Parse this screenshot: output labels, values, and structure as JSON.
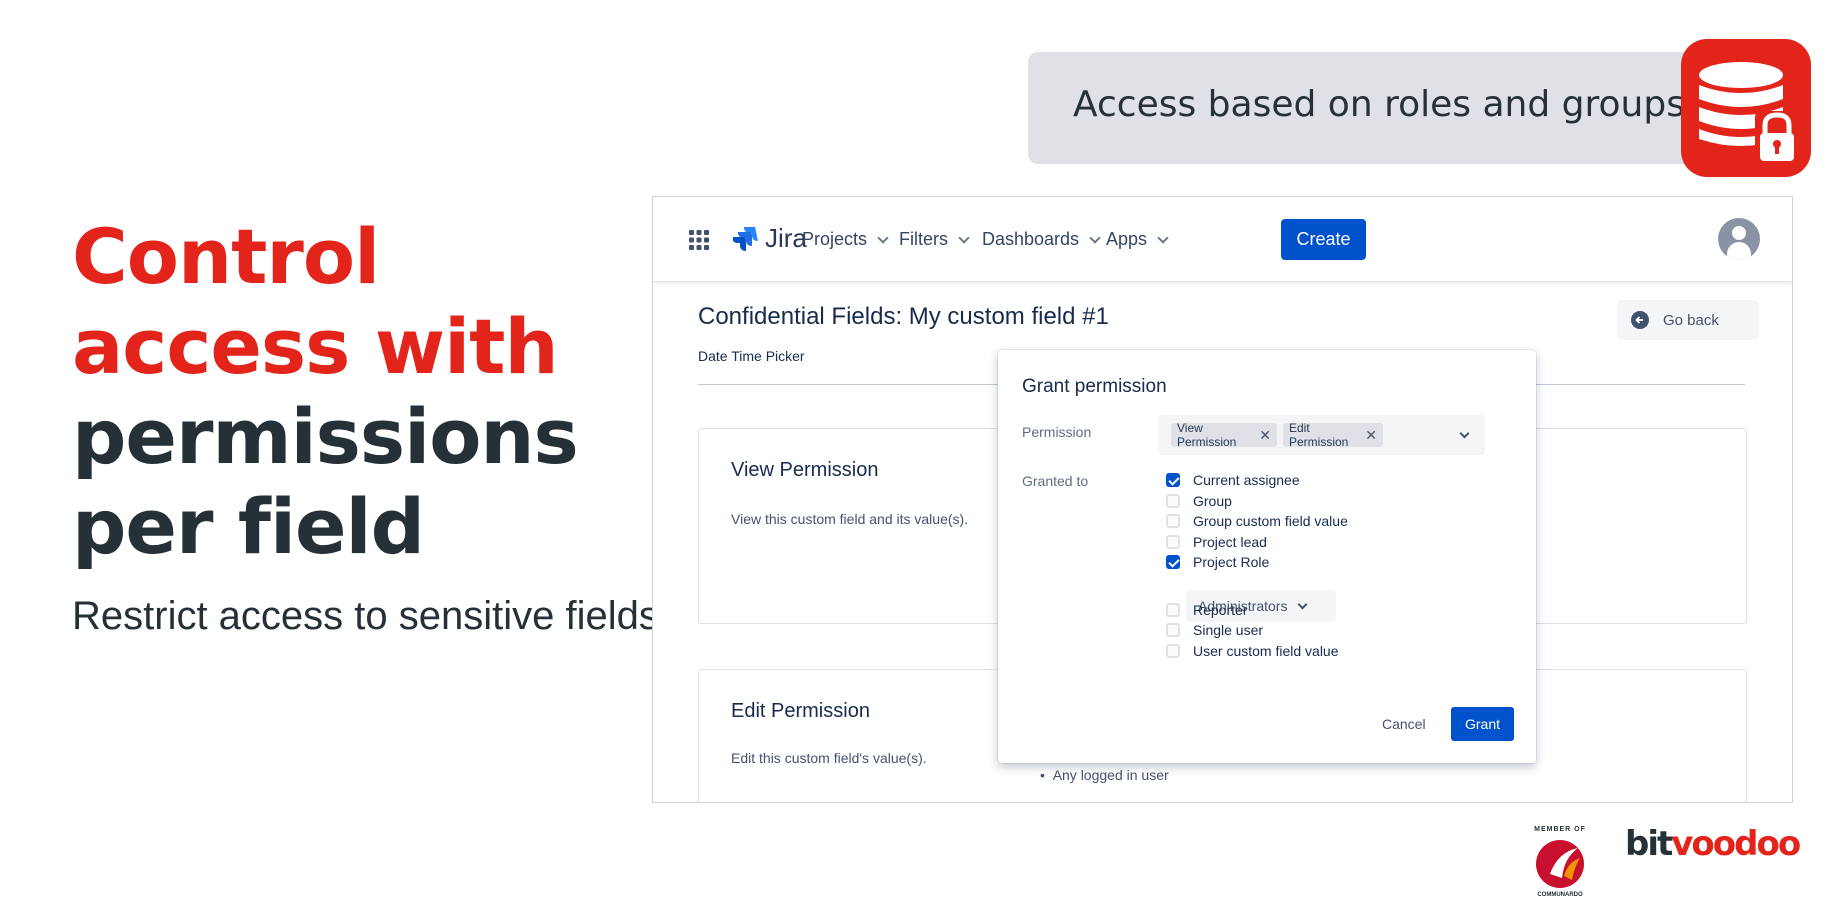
{
  "marketing": {
    "headline_red_1": "Control",
    "headline_red_2": "access with",
    "headline_dark_1": "permissions",
    "headline_dark_2": "per field",
    "subline": "Restrict access to sensitive fields",
    "banner_text": "Access based on roles and groups"
  },
  "app": {
    "brand": "Jira",
    "nav": {
      "projects": "Projects",
      "filters": "Filters",
      "dashboards": "Dashboards",
      "apps": "Apps",
      "create": "Create"
    },
    "page_title": "Confidential Fields: My custom field #1",
    "page_subtitle": "Date Time Picker",
    "go_back": "Go back",
    "cards": {
      "view_title": "View Permission",
      "view_desc": "View this custom field and its value(s).",
      "edit_title": "Edit Permission",
      "edit_desc": "Edit this custom field's value(s).",
      "edit_bullet": "Any logged in user"
    }
  },
  "modal": {
    "title": "Grant permission",
    "permission_label": "Permission",
    "granted_label": "Granted to",
    "tags": [
      "View Permission",
      "Edit Permission"
    ],
    "options": [
      {
        "label": "Current assignee",
        "checked": true
      },
      {
        "label": "Group",
        "checked": false
      },
      {
        "label": "Group custom field value",
        "checked": false
      },
      {
        "label": "Project lead",
        "checked": false
      },
      {
        "label": "Project Role",
        "checked": true
      },
      {
        "label": "Reporter",
        "checked": false
      },
      {
        "label": "Single user",
        "checked": false
      },
      {
        "label": "User custom field value",
        "checked": false
      }
    ],
    "role_value": "Administrators",
    "cancel": "Cancel",
    "grant": "Grant"
  },
  "logos": {
    "member_of": "MEMBER OF",
    "communardo": "COMMUNARDO",
    "bit": "bit",
    "voodoo": "voodoo"
  },
  "colors": {
    "brand_red": "#e3241b",
    "jira_blue": "#0052cc",
    "dark_text": "#253137"
  }
}
